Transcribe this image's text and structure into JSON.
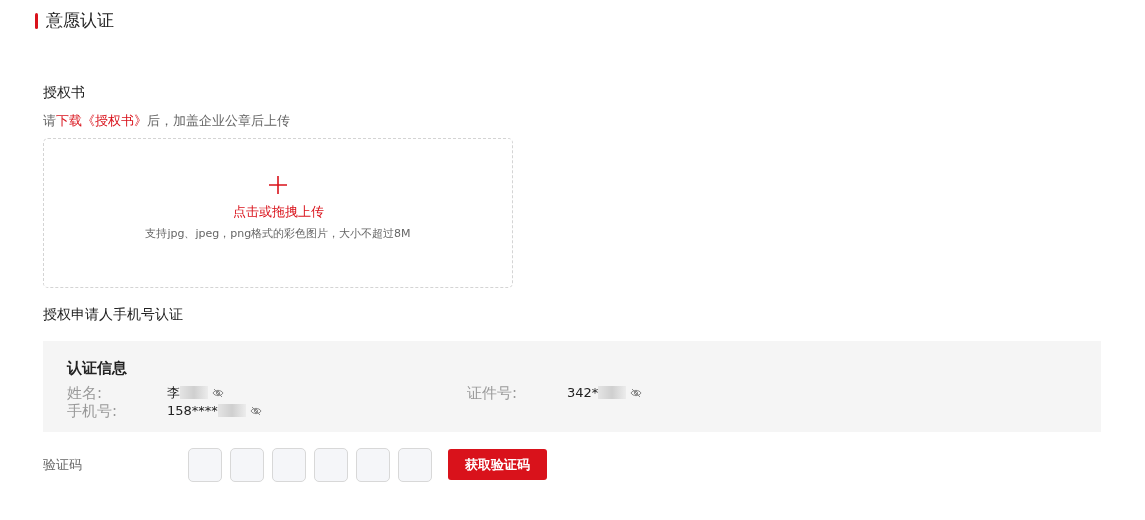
{
  "title": "意愿认证",
  "authorization": {
    "label": "授权书",
    "hint_prefix": "请",
    "hint_link": "下载《授权书》",
    "hint_suffix": "后，加盖企业公章后上传",
    "upload": {
      "action": "点击或拖拽上传",
      "note": "支持jpg、jpeg，png格式的彩色图片，大小不超过8M"
    }
  },
  "phone_section": {
    "label": "授权申请人手机号认证"
  },
  "info": {
    "heading": "认证信息",
    "left_fields": [
      {
        "label": "姓名:",
        "value": "李",
        "masked": true
      },
      {
        "label": "手机号:",
        "value": "158****",
        "masked": true
      }
    ],
    "right_fields": [
      {
        "label": "证件号:",
        "value": "342*",
        "masked": true
      }
    ]
  },
  "verification": {
    "label": "验证码",
    "code_boxes": [
      {
        "filled": false
      },
      {
        "filled": false
      },
      {
        "filled": false
      },
      {
        "filled": false
      },
      {
        "filled": false
      },
      {
        "filled": false
      }
    ],
    "button": "获取验证码"
  }
}
